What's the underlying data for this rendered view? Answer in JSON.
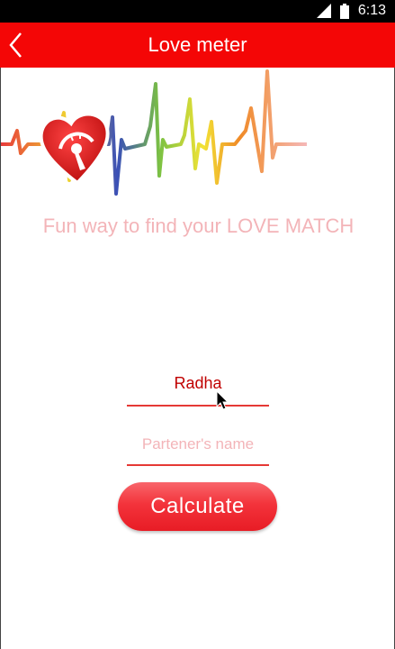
{
  "status_bar": {
    "time": "6:13",
    "icons": [
      "signal-icon",
      "battery-icon"
    ]
  },
  "app_bar": {
    "title": "Love meter",
    "back_icon": "back-arrow-icon",
    "color": "#f40606"
  },
  "banner": {
    "icons": [
      "heart-meter-icon",
      "heartbeat-line"
    ]
  },
  "tagline": "Fun way to find your LOVE MATCH",
  "form": {
    "name_value": "Radha",
    "partner_placeholder": "Partener's name",
    "calculate_label": "Calculate"
  },
  "colors": {
    "accent": "#f40606",
    "tagline": "#f3b4b8",
    "input_text": "#c00000"
  }
}
